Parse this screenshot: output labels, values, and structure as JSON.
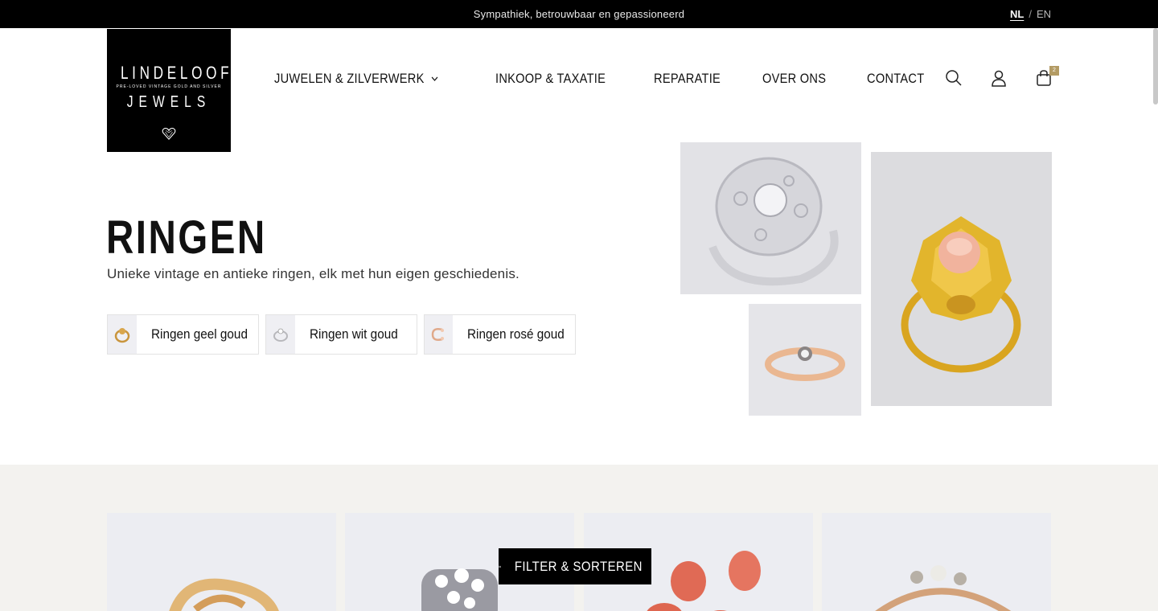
{
  "topbar": {
    "tagline": "Sympathiek, betrouwbaar en gepassioneerd",
    "lang_active": "NL",
    "lang_separator": "/",
    "lang_other": "EN"
  },
  "logo": {
    "line1": "LINDELOOF",
    "line2": "PRE-LOVED VINTAGE GOLD AND SILVER",
    "line3": "JEWELS"
  },
  "nav": {
    "items": [
      {
        "label": "JUWELEN & ZILVERWERK",
        "has_dropdown": true
      },
      {
        "label": "INKOOP & TAXATIE"
      },
      {
        "label": "REPARATIE"
      },
      {
        "label": "OVER ONS"
      },
      {
        "label": "CONTACT"
      }
    ]
  },
  "header_icons": {
    "search": "search-icon",
    "account": "user-icon",
    "cart": "cart-icon",
    "cart_count": "2"
  },
  "hero": {
    "title": "RINGEN",
    "subtitle": "Unieke vintage en antieke ringen, elk met hun eigen geschiedenis."
  },
  "categories": [
    {
      "label": "Ringen geel goud"
    },
    {
      "label": "Ringen wit goud"
    },
    {
      "label": "Ringen rosé goud"
    }
  ],
  "filter": {
    "label": "FILTER & SORTEREN"
  },
  "colors": {
    "accent_gold": "#b39b64",
    "section_bg": "#f3f2ef"
  }
}
